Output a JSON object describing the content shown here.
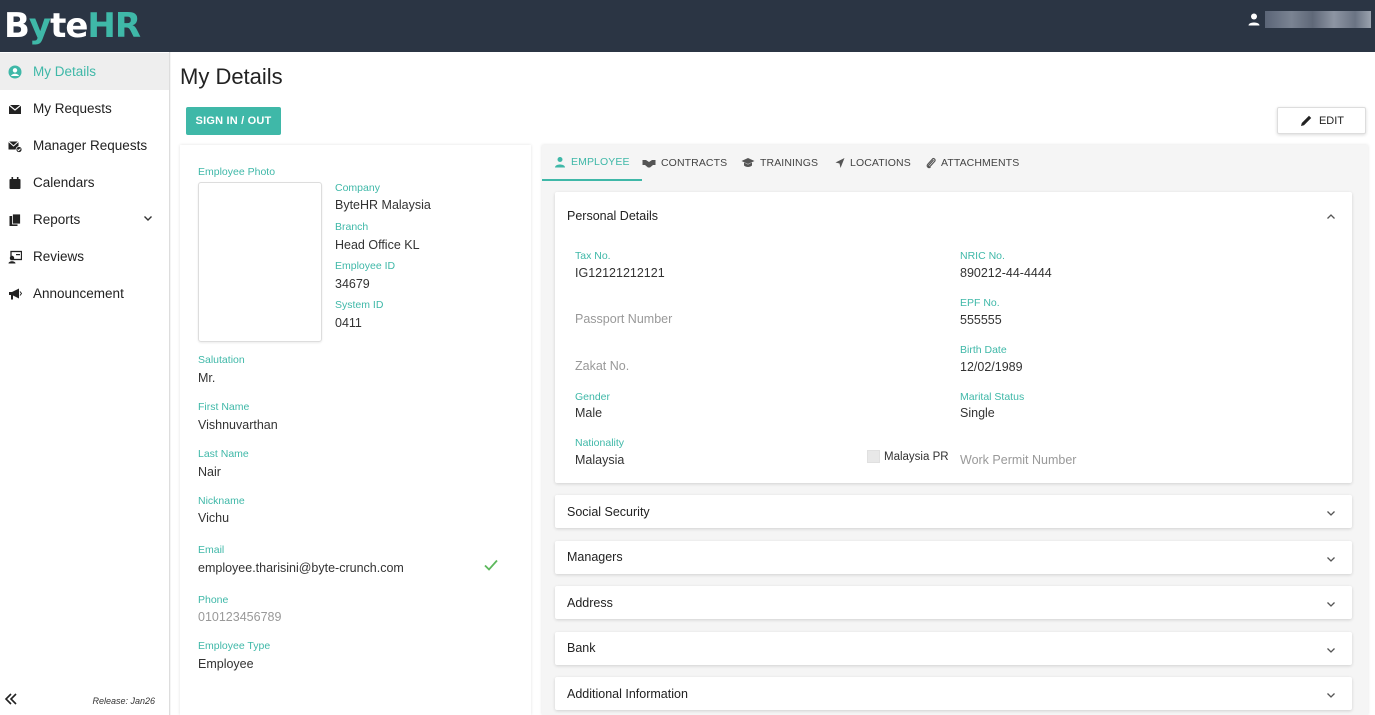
{
  "app": {
    "logo_white": "B",
    "logo_white2": "te",
    "logo_teal": "y",
    "logo_hr": "HR",
    "release": "Release: Jan26"
  },
  "sidebar": {
    "items": [
      {
        "label": "My Details",
        "icon": "user-circle-icon"
      },
      {
        "label": "My Requests",
        "icon": "envelope-icon"
      },
      {
        "label": "Manager Requests",
        "icon": "envelope-check-icon"
      },
      {
        "label": "Calendars",
        "icon": "calendar-icon"
      },
      {
        "label": "Reports",
        "icon": "copy-icon"
      },
      {
        "label": "Reviews",
        "icon": "id-card-icon"
      },
      {
        "label": "Announcement",
        "icon": "bullhorn-icon"
      }
    ]
  },
  "page": {
    "title": "My Details",
    "sign_button": "SIGN IN / OUT",
    "edit_button": "EDIT"
  },
  "employee": {
    "photo_label": "Employee Photo",
    "company_label": "Company",
    "company": "ByteHR Malaysia",
    "branch_label": "Branch",
    "branch": "Head Office KL",
    "employee_id_label": "Employee ID",
    "employee_id": "34679",
    "system_id_label": "System ID",
    "system_id": "0411",
    "salutation_label": "Salutation",
    "salutation": "Mr.",
    "first_name_label": "First Name",
    "first_name": "Vishnuvarthan",
    "last_name_label": "Last Name",
    "last_name": "Nair",
    "nickname_label": "Nickname",
    "nickname": "Vichu",
    "email_label": "Email",
    "email": "employee.tharisini@byte-crunch.com",
    "phone_label": "Phone",
    "phone": "010123456789",
    "employee_type_label": "Employee Type",
    "employee_type": "Employee"
  },
  "tabs": [
    {
      "label": "EMPLOYEE",
      "icon": "user-icon"
    },
    {
      "label": "CONTRACTS",
      "icon": "handshake-icon"
    },
    {
      "label": "TRAININGS",
      "icon": "graduation-cap-icon"
    },
    {
      "label": "LOCATIONS",
      "icon": "location-arrow-icon"
    },
    {
      "label": "ATTACHMENTS",
      "icon": "paperclip-icon"
    }
  ],
  "personal": {
    "title": "Personal Details",
    "tax_label": "Tax No.",
    "tax": "IG12121212121",
    "nric_label": "NRIC No.",
    "nric": "890212-44-4444",
    "passport_placeholder": "Passport Number",
    "epf_label": "EPF No.",
    "epf": "555555",
    "zakat_placeholder": "Zakat No.",
    "birth_label": "Birth Date",
    "birth": "12/02/1989",
    "gender_label": "Gender",
    "gender": "Male",
    "marital_label": "Marital Status",
    "marital": "Single",
    "nationality_label": "Nationality",
    "nationality": "Malaysia",
    "pr_label": "Malaysia PR",
    "work_permit_placeholder": "Work Permit Number"
  },
  "sections": [
    {
      "title": "Social Security"
    },
    {
      "title": "Managers"
    },
    {
      "title": "Address"
    },
    {
      "title": "Bank"
    },
    {
      "title": "Additional Information"
    }
  ],
  "colors": {
    "accent": "#3fb8a8",
    "topbar": "#2b3544"
  }
}
